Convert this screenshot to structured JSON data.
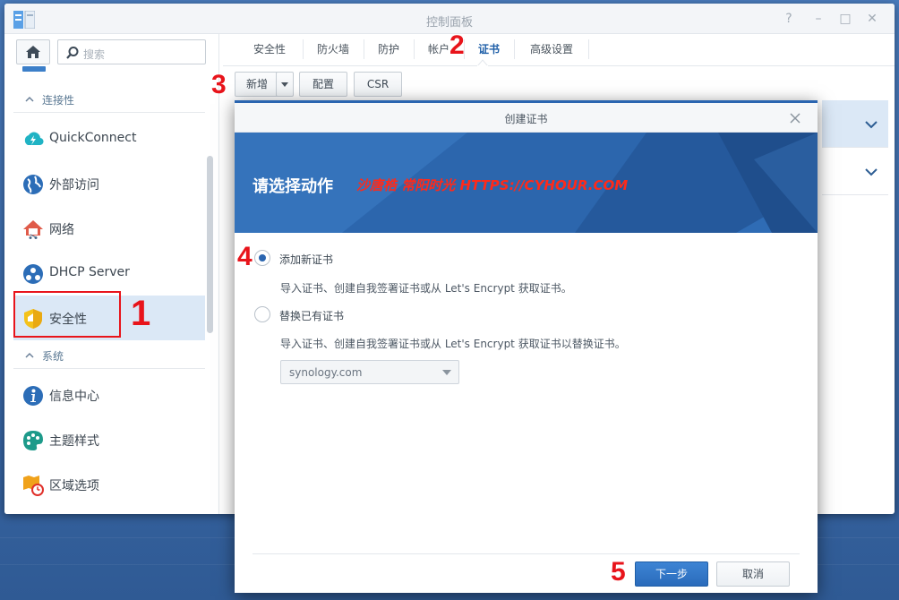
{
  "window": {
    "title": "控制面板",
    "controls": {
      "help": "?",
      "minimize": "–",
      "maximize": "□",
      "close": "✕"
    }
  },
  "sidebar": {
    "search_placeholder": "搜索",
    "sections": [
      {
        "label": "连接性",
        "items": [
          {
            "label": "QuickConnect",
            "icon": "quickconnect-icon"
          },
          {
            "label": "外部访问",
            "icon": "globe-icon"
          },
          {
            "label": "网络",
            "icon": "network-home-icon"
          },
          {
            "label": "DHCP Server",
            "icon": "dhcp-icon"
          },
          {
            "label": "安全性",
            "icon": "shield-icon",
            "active": true
          }
        ]
      },
      {
        "label": "系统",
        "items": [
          {
            "label": "信息中心",
            "icon": "info-icon"
          },
          {
            "label": "主题样式",
            "icon": "palette-icon"
          },
          {
            "label": "区域选项",
            "icon": "region-clock-icon"
          }
        ]
      }
    ]
  },
  "tabs": [
    {
      "label": "安全性"
    },
    {
      "label": "防火墙"
    },
    {
      "label": "防护"
    },
    {
      "label": "帐户"
    },
    {
      "label": "证书",
      "active": true
    },
    {
      "label": "高级设置"
    }
  ],
  "toolbar": {
    "create": "新增",
    "configure": "配置",
    "csr": "CSR"
  },
  "dialog": {
    "title": "创建证书",
    "banner_title": "请选择动作",
    "watermark": "沙唐梏 常阳时光 HTTPS://CYHOUR.COM",
    "option1": {
      "label": "添加新证书",
      "desc": "导入证书、创建自我签署证书或从 Let's Encrypt 获取证书。",
      "checked": true
    },
    "option2": {
      "label": "替换已有证书",
      "desc": "导入证书、创建自我签署证书或从 Let's Encrypt 获取证书以替换证书。",
      "checked": false
    },
    "select_value": "synology.com",
    "next": "下一步",
    "cancel": "取消"
  },
  "annotations": [
    "1",
    "2",
    "3",
    "4",
    "5"
  ],
  "colors": {
    "accent": "#2a65b0",
    "annotation_red": "#e8141b",
    "active_row": "#dbe8f6",
    "desktop": "#3d6fae"
  }
}
